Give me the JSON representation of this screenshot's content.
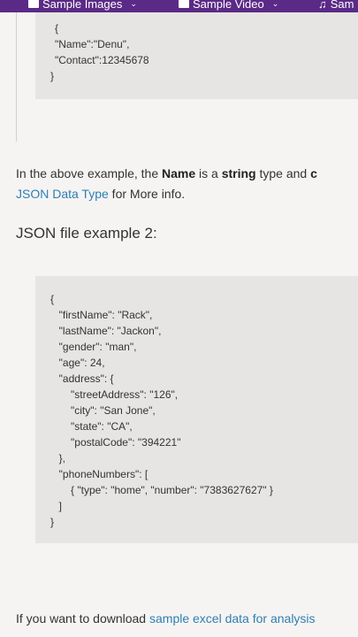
{
  "nav": {
    "items": [
      {
        "label": "Sample Images",
        "icon": "image-icon"
      },
      {
        "label": "Sample Video",
        "icon": "video-icon"
      },
      {
        "label": "Sam",
        "icon": "music-icon"
      }
    ]
  },
  "code1": {
    "lines": [
      "{",
      "\"Name\":\"Denu\",",
      "\"Contact\":12345678",
      "}"
    ]
  },
  "para1": {
    "text_pre": "In the above example, the ",
    "bold1": "Name",
    "text_mid": " is a ",
    "bold2": "string",
    "text_post": " type and ",
    "bold3": "c",
    "link": "JSON Data Type",
    "link_after": " for More info."
  },
  "heading2": "JSON file example 2:",
  "code2": {
    "lines": [
      "{",
      "  \"firstName\": \"Rack\",",
      "  \"lastName\": \"Jackon\",",
      "  \"gender\": \"man\",",
      "  \"age\": 24,",
      "  \"address\": {",
      "      \"streetAddress\": \"126\",",
      "      \"city\": \"San Jone\",",
      "      \"state\": \"CA\",",
      "      \"postalCode\": \"394221\"",
      "  },",
      "  \"phoneNumbers\": [",
      "      { \"type\": \"home\", \"number\": \"7383627627\" }",
      "  ]",
      "}"
    ]
  },
  "para2": {
    "text": "If you want to download ",
    "link": "sample excel data for analysis"
  }
}
